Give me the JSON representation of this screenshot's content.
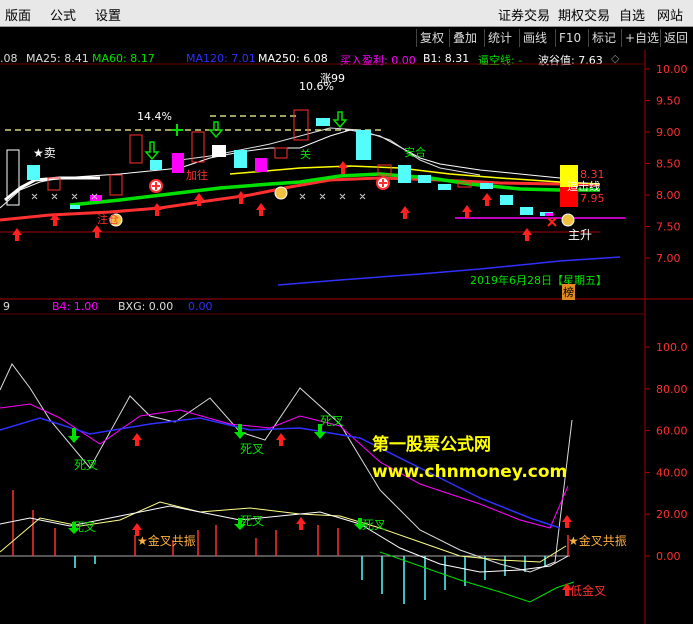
{
  "menubar": {
    "left": [
      "版面",
      "公式",
      "设置"
    ],
    "right": [
      "证券交易",
      "期权交易",
      "自选",
      "网站"
    ]
  },
  "toolbar": [
    "复权",
    "叠加",
    "统计",
    "画线",
    "F10",
    "标记",
    "+自选",
    "返回"
  ],
  "main_legend": {
    "ma5_partial": ".08",
    "ma25": "MA25: 8.41",
    "ma60": "MA60: 8.17",
    "ma120": "MA120: 7.01",
    "ma250": "MA250: 6.08",
    "buy_profit": "买入盈利: 0.00",
    "b1": "B1: 8.31",
    "force_line": "逼空线: -",
    "wave_value": "波谷值: 7.63"
  },
  "sub_legend": {
    "prefix": "9",
    "b4": "B4: 1.00",
    "bxg": "BXG: 0.00",
    "blue_val": "0.00"
  },
  "main_axis": [
    "10.00",
    "9.50",
    "9.00",
    "8.50",
    "8.00",
    "7.50",
    "7.00"
  ],
  "sub_axis": [
    "100.0",
    "80.00",
    "60.00",
    "40.00",
    "20.00",
    "0.00"
  ],
  "date_label": "2019年6月28日【星期五】",
  "tags": {
    "pct1": "14.4%",
    "pct2": "10.6%",
    "sell": "★卖",
    "t99": "涨99",
    "guan": "关",
    "anhe": "安合",
    "buy_tag": "追击线",
    "zhu_sheng": "主升",
    "bang": "榜",
    "price_828": "8.31",
    "price_795": "7.95",
    "sihe": "死叉",
    "jinzhen": "★金叉共振",
    "jinzhen2": "★金叉共振",
    "dijin": "低金叉",
    "watermark1": "第一股票公式网",
    "watermark2": "www.chnmoney.com",
    "cangwei": "注仓",
    "zhiwang": "加往"
  },
  "colors": {
    "bg": "#000000",
    "up": "#ff3030",
    "down": "#54fcfc",
    "yellow": "#ffff00",
    "green": "#00e000",
    "magenta": "#ff00ff",
    "blue": "#3030ff"
  }
}
